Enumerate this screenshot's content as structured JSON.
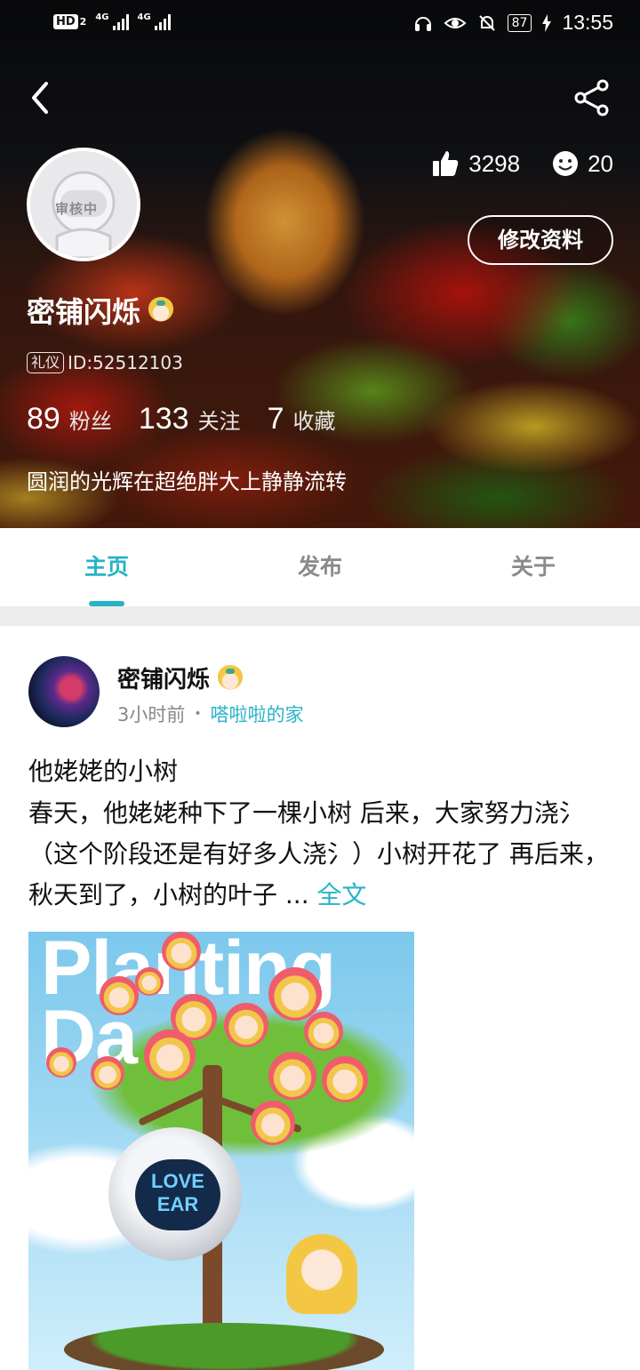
{
  "status_bar": {
    "hd_label": "HD",
    "hd_sub": "2",
    "net1": "4G",
    "net2": "4G",
    "battery": "87",
    "time": "13:55"
  },
  "profile": {
    "avatar_status": "审核中",
    "likes": "3298",
    "smiles": "20",
    "edit_button": "修改资料",
    "username": "密铺闪烁",
    "tag": "礼仪",
    "id_text": "ID:52512103",
    "fans_count": "89",
    "fans_label": "粉丝",
    "following_count": "133",
    "following_label": "关注",
    "favorites_count": "7",
    "favorites_label": "收藏",
    "bio": "圆润的光辉在超绝胖大上静静流转"
  },
  "tabs": [
    {
      "label": "主页",
      "active": true
    },
    {
      "label": "发布",
      "active": false
    },
    {
      "label": "关于",
      "active": false
    }
  ],
  "post": {
    "author": "密铺闪烁",
    "time": "3小时前",
    "separator": "•",
    "circle": "嗒啦啦的家",
    "title": "他姥姥的小树",
    "body": "春天，他姥姥种下了一棵小树 后来，大家努力浇氵（这个阶段还是有好多人浇氵）小树开花了 再后来，秋天到了，小树的叶子 ...",
    "more": "全文",
    "image_title_line1": "Planting",
    "image_title_line2": "Da",
    "robot_screen_line1": "LOVE",
    "robot_screen_line2": "EAR"
  },
  "colors": {
    "accent": "#27b3c6",
    "tab_inactive": "#8a8a8a",
    "divider": "#ececec"
  },
  "icons": {
    "back": "chevron-left-icon",
    "share": "share-icon",
    "like": "thumbs-up-icon",
    "smile": "smile-icon"
  }
}
